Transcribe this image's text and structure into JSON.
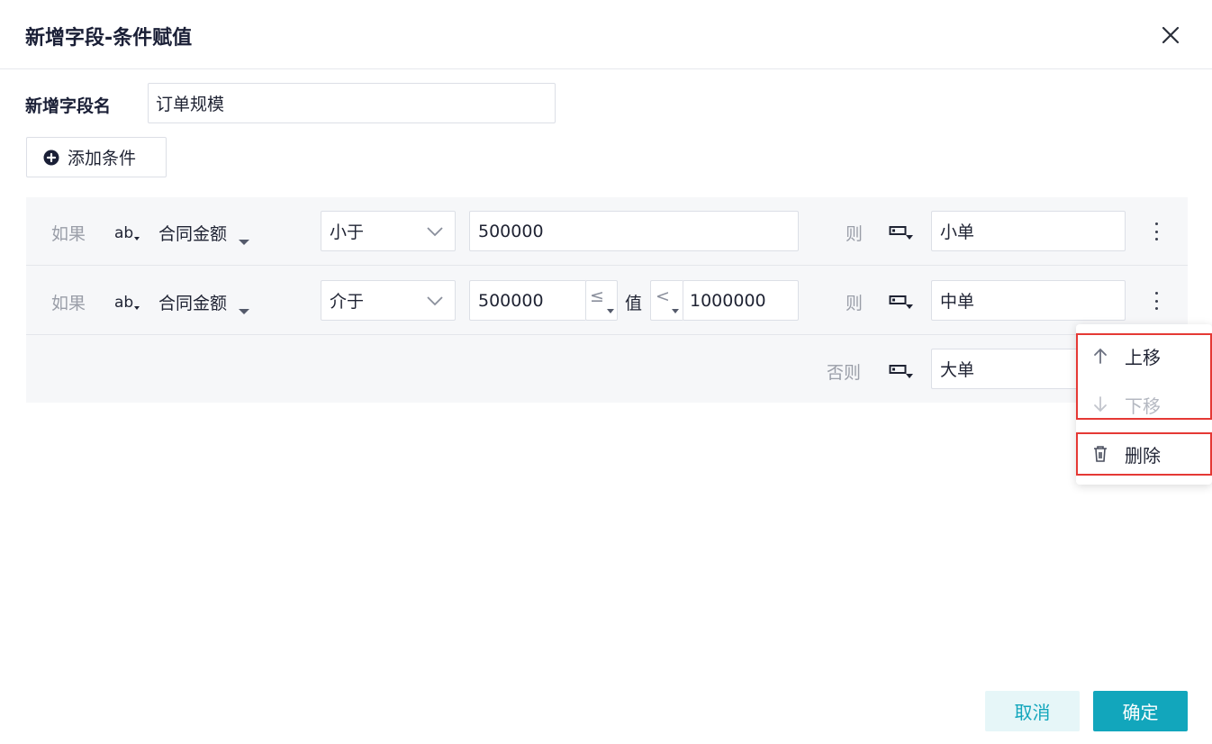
{
  "dialog": {
    "title": "新增字段-条件赋值",
    "field_name_label": "新增字段名",
    "field_name_value": "订单规模",
    "add_condition_label": "添加条件"
  },
  "conditions": [
    {
      "if_label": "如果",
      "type_icon": "ab",
      "field": "合同金额",
      "operator": "小于",
      "value": "500000",
      "then_label": "则",
      "result": "小单"
    },
    {
      "if_label": "如果",
      "type_icon": "ab",
      "field": "合同金额",
      "operator": "介于",
      "value_from": "500000",
      "from_comparator": "≤",
      "middle_label": "值",
      "to_comparator": "<",
      "value_to": "1000000",
      "then_label": "则",
      "result": "中单"
    }
  ],
  "else_row": {
    "else_label": "否则",
    "result": "大单"
  },
  "context_menu": {
    "move_up": "上移",
    "move_down": "下移",
    "delete": "删除"
  },
  "footer": {
    "cancel": "取消",
    "confirm": "确定"
  },
  "colors": {
    "accent": "#12a6bc",
    "highlight_box": "#e53935",
    "condition_bg": "#f6f7f9"
  }
}
